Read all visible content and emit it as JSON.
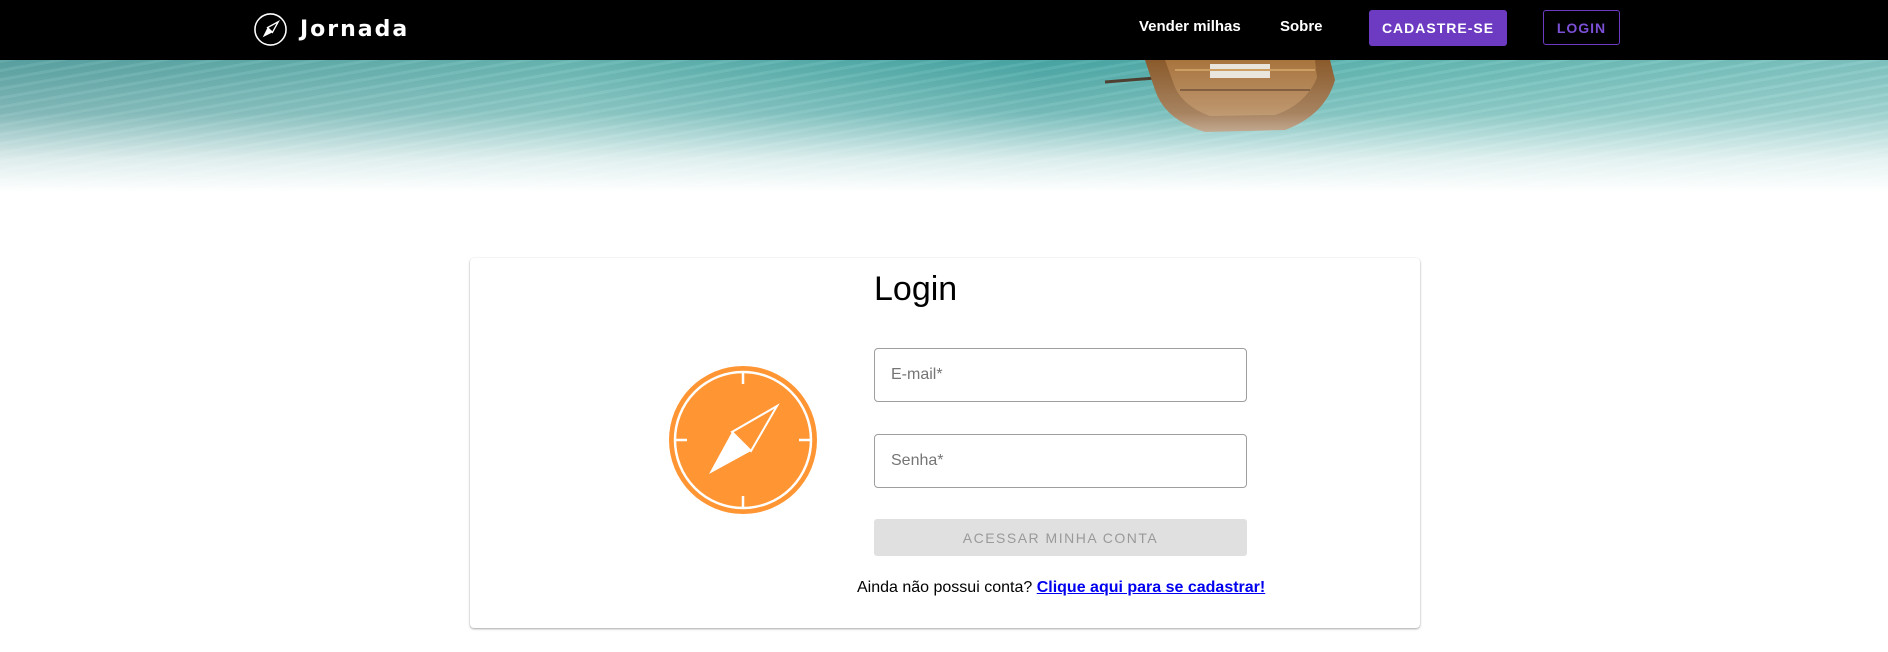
{
  "nav": {
    "brand": "Jornada",
    "links": [
      "Vender milhas",
      "Sobre"
    ],
    "signup_label": "CADASTRE-SE",
    "login_label": "LOGIN"
  },
  "login": {
    "title": "Login",
    "email_placeholder": "E-mail*",
    "password_placeholder": "Senha*",
    "submit_label": "ACESSAR MINHA CONTA",
    "no_account_text": "Ainda não possui conta?",
    "signup_link": "Clique aqui para se cadastrar!"
  },
  "colors": {
    "nav_background": "#000000",
    "accent_purple": "#6c3bc2",
    "logo_orange": "#ff9533",
    "link_blue": "#0000ee",
    "disabled_button": "#e0e0e0"
  },
  "icons": [
    "compass-icon",
    "compass-logo"
  ]
}
